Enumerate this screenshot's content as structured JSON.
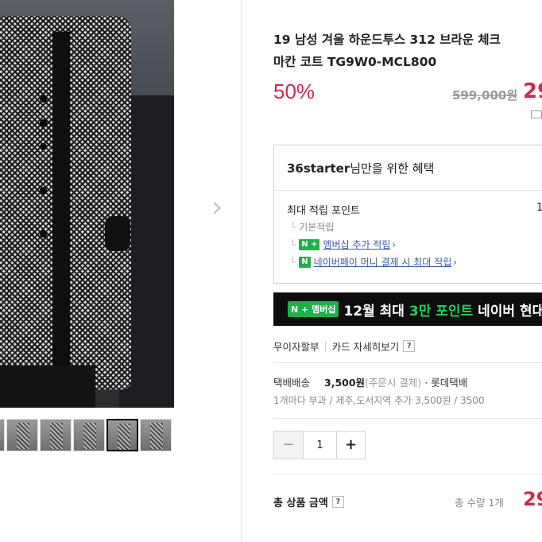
{
  "product": {
    "title_line1": "19 남성 겨울 하운드투스 312 브라운 체크 ",
    "title_line2": "마칸 코트 TG9W0-MCL800",
    "discount": "50%",
    "original_price": "599,000원",
    "sale_price": "29",
    "image_next_icon": "chevron-right-icon"
  },
  "benefits": {
    "user": "36starter",
    "title_suffix": "님만을 위한 혜택",
    "max_points_label": "최대 적립 포인트",
    "max_points_value": "1",
    "basic_label": "기본적립",
    "membership_badge": "N +",
    "membership_link": "멤버십 추가 적립",
    "npay_badge": "N",
    "npay_link": "네이버페이 머니 결제 시 최대 적립"
  },
  "banner": {
    "badge": "N + 멤버십",
    "text_before": "12월 최대 ",
    "text_highlight": "3만 포인트",
    "text_after": " 네이버 현대카"
  },
  "installment": {
    "label": "무이자할부",
    "card_link": "카드 자세히보기",
    "help": "?"
  },
  "shipping": {
    "method": "택배배송",
    "fee": "3,500원",
    "condition": "(주문시 결제)",
    "carrier": "· 롯데택배",
    "note": "1개마다 부과 / 제주,도서지역 추가 3,500원 / 3500"
  },
  "quantity": {
    "minus": "−",
    "value": "1",
    "plus": "+"
  },
  "total": {
    "label": "총 상품 금액",
    "help": "?",
    "qty_text": "총 수량 1개",
    "price": "29"
  },
  "colors": {
    "accent": "#d0274b",
    "naver_green": "#19b24b",
    "link": "#3a5ba8"
  }
}
